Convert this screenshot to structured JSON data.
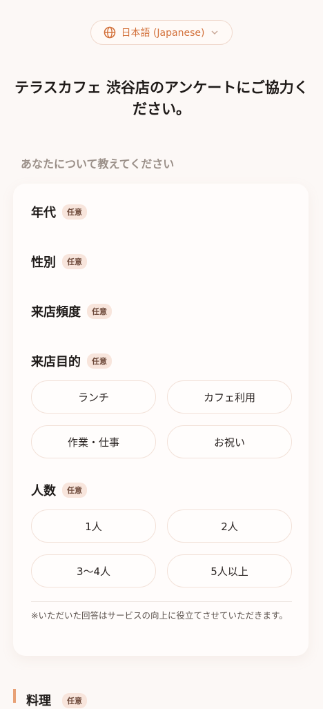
{
  "language": {
    "label": "日本語 (Japanese)",
    "icon": "globe-icon",
    "chevron": "chevron-down-icon",
    "accent": "#d2703a"
  },
  "page": {
    "title": "テラスカフェ 渋谷店のアンケートにご協力ください。"
  },
  "section": {
    "label": "あなたについて教えてください"
  },
  "fields": {
    "age": {
      "label": "年代",
      "badge": "任意"
    },
    "gender": {
      "label": "性別",
      "badge": "任意"
    },
    "frequency": {
      "label": "来店頻度",
      "badge": "任意"
    },
    "purpose": {
      "label": "来店目的",
      "badge": "任意",
      "options": [
        "ランチ",
        "カフェ利用",
        "作業・仕事",
        "お祝い"
      ]
    },
    "party": {
      "label": "人数",
      "badge": "任意",
      "options": [
        "1人",
        "2人",
        "3〜4人",
        "5人以上"
      ]
    }
  },
  "note": "※いただいた回答はサービスの向上に役立てさせていただきます。",
  "next_section": {
    "label": "料理",
    "badge": "任意"
  }
}
